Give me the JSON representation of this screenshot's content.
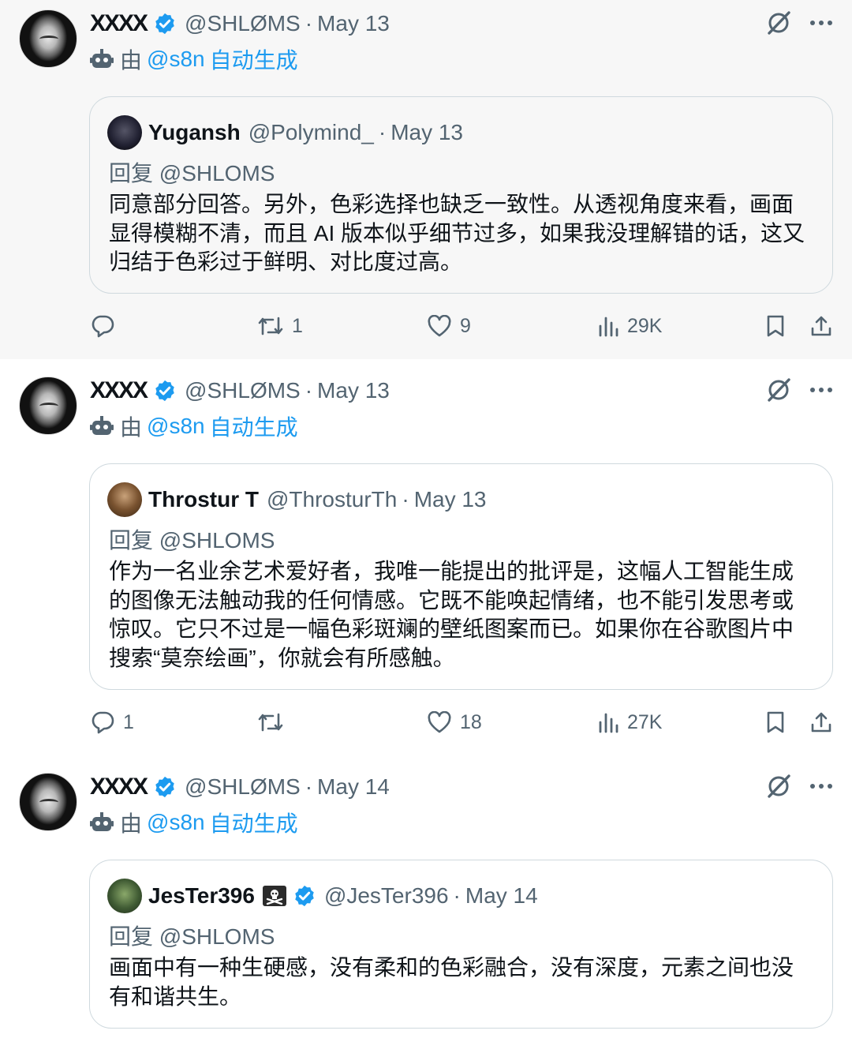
{
  "colors": {
    "accent": "#1d9bf0",
    "muted": "#536471",
    "border": "#cfd9de",
    "text": "#0f1419"
  },
  "icons": {
    "bot": "robot-icon",
    "verified": "verified-badge-icon",
    "grok": "grok-icon",
    "more": "more-icon",
    "reply": "reply-icon",
    "repost": "repost-icon",
    "like": "heart-icon",
    "views": "views-icon",
    "bookmark": "bookmark-icon",
    "share": "share-icon",
    "flag": "pirate-flag-icon"
  },
  "posts": [
    {
      "author_glyph": "XXXX",
      "handle": "@SHLØMS",
      "sep": "·",
      "date": "May 13",
      "auto_prefix": "由",
      "auto_link": "@s8n",
      "auto_suffix": "自动生成",
      "quote": {
        "name": "Yugansh",
        "handle": "@Polymind_",
        "sep": "·",
        "date": "May 13",
        "reply_to": "回复 @SHLOMS",
        "text": "同意部分回答。另外，色彩选择也缺乏一致性。从透视角度来看，画面显得模糊不清，而且 AI 版本似乎细节过多，如果我没理解错的话，这又归结于色彩过于鲜明、对比度过高。"
      },
      "stats": {
        "replies": "",
        "reposts": "1",
        "likes": "9",
        "views": "29K"
      }
    },
    {
      "author_glyph": "XXXX",
      "handle": "@SHLØMS",
      "sep": "·",
      "date": "May 13",
      "auto_prefix": "由",
      "auto_link": "@s8n",
      "auto_suffix": "自动生成",
      "quote": {
        "name": "Throstur T",
        "handle": "@ThrosturTh",
        "sep": "·",
        "date": "May 13",
        "reply_to": "回复 @SHLOMS",
        "text": "作为一名业余艺术爱好者，我唯一能提出的批评是，这幅人工智能生成的图像无法触动我的任何情感。它既不能唤起情绪，也不能引发思考或惊叹。它只不过是一幅色彩斑斓的壁纸图案而已。如果你在谷歌图片中搜索“莫奈绘画”，你就会有所感触。"
      },
      "stats": {
        "replies": "1",
        "reposts": "",
        "likes": "18",
        "views": "27K"
      }
    },
    {
      "author_glyph": "XXXX",
      "handle": "@SHLØMS",
      "sep": "·",
      "date": "May 14",
      "auto_prefix": "由",
      "auto_link": "@s8n",
      "auto_suffix": "自动生成",
      "quote": {
        "name": "JesTer396",
        "handle": "@JesTer396",
        "sep": "·",
        "date": "May 14",
        "reply_to": "回复 @SHLOMS",
        "text": "画面中有一种生硬感，没有柔和的色彩融合，没有深度，元素之间也没有和谐共生。"
      }
    }
  ]
}
